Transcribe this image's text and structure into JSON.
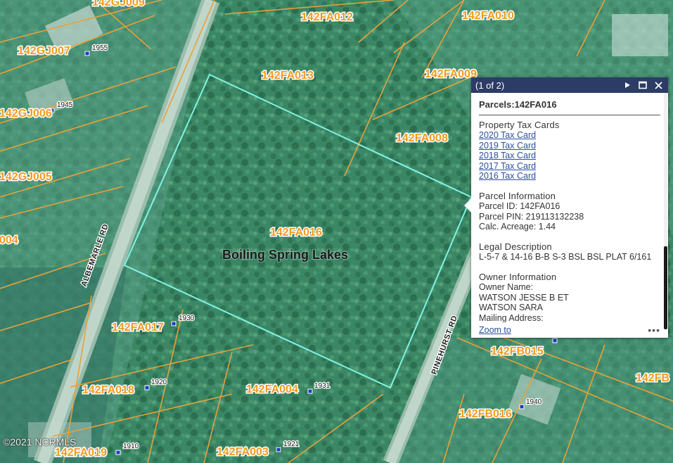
{
  "map": {
    "parcels": [
      {
        "id": "142GJ009"
      },
      {
        "id": "142FA012"
      },
      {
        "id": "142FA010"
      },
      {
        "id": "142GJ007"
      },
      {
        "id": "142FA013"
      },
      {
        "id": "142FA009"
      },
      {
        "id": "142GJ006"
      },
      {
        "id": "142FA008"
      },
      {
        "id": "142GJ005"
      },
      {
        "id": "142FA016"
      },
      {
        "id": "004"
      },
      {
        "id": "142FA017"
      },
      {
        "id": "142FB015"
      },
      {
        "id": "142FA018"
      },
      {
        "id": "142FA004"
      },
      {
        "id": "142FB"
      },
      {
        "id": "142FB016"
      },
      {
        "id": "142FA019"
      },
      {
        "id": "142FA003"
      }
    ],
    "addresses": [
      "1955",
      "1945",
      "1930",
      "1920",
      "1931",
      "1940",
      "1910",
      "1921"
    ],
    "roads": [
      "ALBEMARLE RD",
      "PINEHURST RD"
    ],
    "town": "Boiling Spring Lakes",
    "copyright": "©2021 NCRMLS",
    "colors": {
      "parcel_line": "#e8a13a",
      "selection": "#7ff5e6",
      "label": "#f59a1e",
      "address_marker": "#1a3fc4"
    }
  },
  "popup": {
    "count": "(1 of 2)",
    "title": "Parcels:142FA016",
    "tax_heading": "Property Tax Cards",
    "tax_cards": [
      "2020 Tax Card",
      "2019 Tax Card",
      "2018 Tax Card",
      "2017 Tax Card",
      "2016 Tax Card"
    ],
    "info_heading": "Parcel Information",
    "parcel_id": "Parcel ID: 142FA016",
    "parcel_pin": "Parcel PIN: 219113132238",
    "acreage": "Calc. Acreage: 1.44",
    "legal_heading": "Legal Description",
    "legal_text": "L-5-7 & 14-16 B-B S-3 BSL BSL PLAT 6/161",
    "owner_heading": "Owner Information",
    "owner_name_label": "Owner Name:",
    "owners": [
      "WATSON JESSE B ET",
      "WATSON SARA"
    ],
    "mailing_label": "Mailing Address:",
    "zoom_label": "Zoom to",
    "more_label": "•••",
    "icons": {
      "next": "play-icon",
      "maximize": "maximize-icon",
      "close": "close-icon",
      "more": "more-icon"
    }
  }
}
